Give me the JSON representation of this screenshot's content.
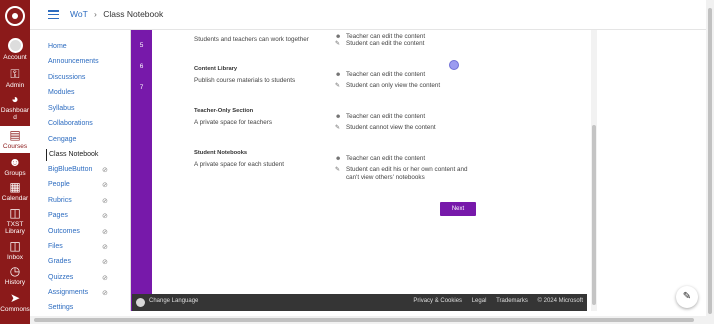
{
  "global_nav": {
    "items": [
      {
        "label": "Account",
        "icon": "account-icon"
      },
      {
        "label": "Admin",
        "icon": "admin-icon"
      },
      {
        "label": "Dashboard",
        "icon": "dashboard-icon"
      },
      {
        "label": "Courses",
        "icon": "courses-icon"
      },
      {
        "label": "Groups",
        "icon": "groups-icon"
      },
      {
        "label": "Calendar",
        "icon": "calendar-icon"
      },
      {
        "label": "TXST Library",
        "icon": "library-icon"
      },
      {
        "label": "Inbox",
        "icon": "inbox-icon"
      },
      {
        "label": "History",
        "icon": "history-icon"
      },
      {
        "label": "Commons",
        "icon": "commons-icon"
      }
    ],
    "dashboard_label_1": "Dashboar",
    "dashboard_label_2": "d",
    "library_label_1": "TXST",
    "library_label_2": "Library"
  },
  "breadcrumb": {
    "course": "WoT",
    "page": "Class Notebook"
  },
  "course_nav": {
    "items": [
      {
        "label": "Home"
      },
      {
        "label": "Announcements"
      },
      {
        "label": "Discussions"
      },
      {
        "label": "Modules"
      },
      {
        "label": "Syllabus"
      },
      {
        "label": "Collaborations"
      },
      {
        "label": "Cengage"
      },
      {
        "label": "Class Notebook"
      },
      {
        "label": "BigBlueButton"
      },
      {
        "label": "People"
      },
      {
        "label": "Rubrics"
      },
      {
        "label": "Pages"
      },
      {
        "label": "Outcomes"
      },
      {
        "label": "Files"
      },
      {
        "label": "Grades"
      },
      {
        "label": "Quizzes"
      },
      {
        "label": "Assignments"
      },
      {
        "label": "Settings"
      }
    ],
    "active": "Class Notebook"
  },
  "notebook": {
    "steps": [
      "5",
      "6",
      "7"
    ],
    "sections": [
      {
        "title": "",
        "description": "Students and teachers can work together",
        "teacher_perm": "Teacher can edit the content",
        "student_perm": "Student can edit the content"
      },
      {
        "title": "Content Library",
        "description": "Publish course materials to students",
        "teacher_perm": "Teacher can edit the content",
        "student_perm": "Student can only view the content"
      },
      {
        "title": "Teacher-Only Section",
        "description": "A private space for teachers",
        "teacher_perm": "Teacher can edit the content",
        "student_perm": "Student cannot view the content"
      },
      {
        "title": "Student Notebooks",
        "description": "A private space for each student",
        "teacher_perm": "Teacher can edit the content",
        "student_perm": "Student can edit his or her own content and",
        "student_perm_line2": "can't view others' notebooks"
      }
    ],
    "next_label": "Next",
    "accent": "#7719aa"
  },
  "footer": {
    "language": "Change Language",
    "links": [
      "Privacy & Cookies",
      "Legal",
      "Trademarks",
      "© 2024 Microsoft"
    ]
  },
  "colors": {
    "global_nav": "#8b1a1a",
    "link": "#2d6cc0"
  }
}
